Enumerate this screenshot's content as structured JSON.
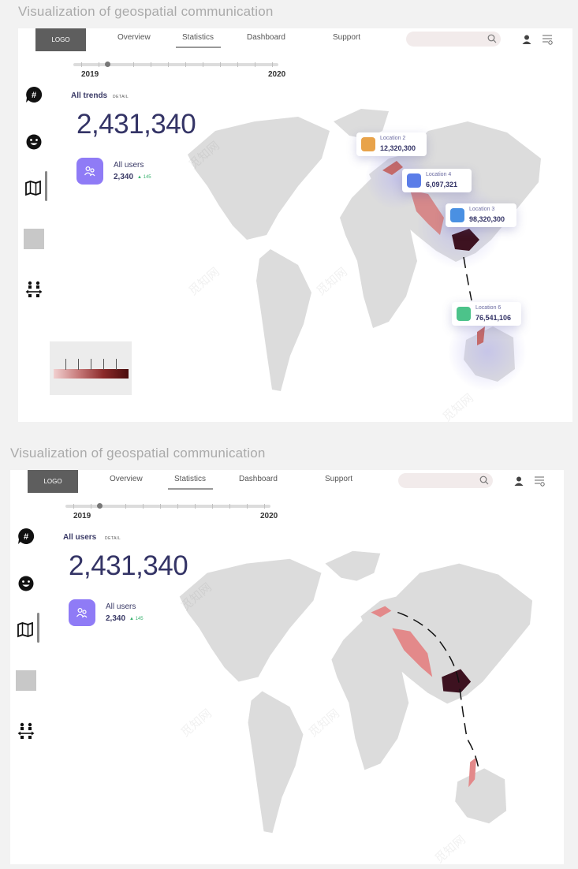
{
  "page_title": "Visualization of geospatial communication",
  "logo_text": "LOGO",
  "nav": [
    "Overview",
    "Statistics",
    "Dashboard",
    "Support"
  ],
  "active_nav": "Statistics",
  "timeline": {
    "start_year": "2019",
    "end_year": "2020"
  },
  "sidebar_icons": [
    "hashtag-chat-icon",
    "smiley-icon",
    "map-icon",
    "placeholder-square",
    "transfer-people-icon"
  ],
  "panel1": {
    "section_label": "All trends",
    "detail_tag": "DETAIL",
    "big_number": "2,431,340",
    "users_label": "All users",
    "users_count": "2,340",
    "users_delta": "▲ 145",
    "tooltips": [
      {
        "name": "Location 2",
        "value": "12,320,300",
        "icon_color": "#e8a34a"
      },
      {
        "name": "Location 4",
        "value": "6,097,321",
        "icon_color": "#5b7de8"
      },
      {
        "name": "Location 3",
        "value": "98,320,300",
        "icon_color": "#4a90e2"
      },
      {
        "name": "Location 6",
        "value": "76,541,106",
        "icon_color": "#4cc38a"
      }
    ]
  },
  "panel2": {
    "section_label": "All users",
    "detail_tag": "DETAIL",
    "big_number": "2,431,340",
    "users_label": "All users",
    "users_count": "2,340",
    "users_delta": "▲ 145"
  },
  "colors": {
    "accent_purple": "#8f7bf6",
    "heat_light": "#f1a3a3",
    "heat_dark": "#3d1220",
    "land": "#dcdcdc"
  },
  "watermark_text": "觅知网"
}
